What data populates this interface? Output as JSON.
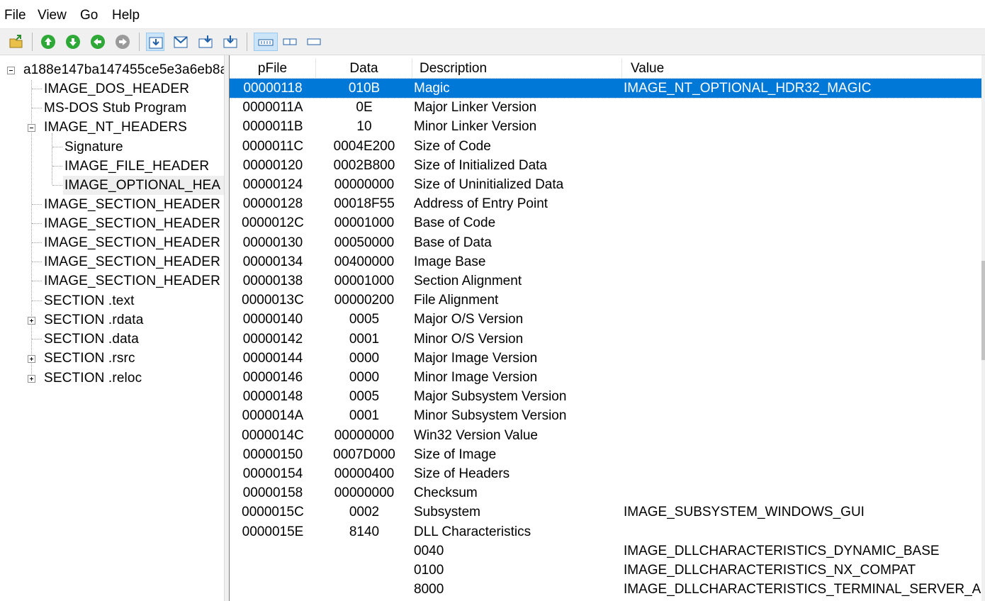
{
  "menu": [
    "File",
    "View",
    "Go",
    "Help"
  ],
  "toolbar": {
    "icons": [
      "open-icon",
      "arrow-up-icon",
      "arrow-down-icon",
      "arrow-back-icon",
      "arrow-forward-icon",
      "expand-view-icon",
      "mail-view-icon",
      "import-icon",
      "export-icon",
      "details-view-icon",
      "list-view-icon",
      "compact-view-icon"
    ]
  },
  "tree": {
    "root": "a188e147ba147455ce5e3a6eb8a",
    "items": [
      "IMAGE_DOS_HEADER",
      "MS-DOS Stub Program",
      "IMAGE_NT_HEADERS",
      "Signature",
      "IMAGE_FILE_HEADER",
      "IMAGE_OPTIONAL_HEA",
      "IMAGE_SECTION_HEADER",
      "IMAGE_SECTION_HEADER",
      "IMAGE_SECTION_HEADER",
      "IMAGE_SECTION_HEADER",
      "IMAGE_SECTION_HEADER",
      "SECTION .text",
      "SECTION .rdata",
      "SECTION .data",
      "SECTION .rsrc",
      "SECTION .reloc"
    ]
  },
  "table": {
    "columns": [
      "pFile",
      "Data",
      "Description",
      "Value"
    ],
    "rows": [
      {
        "pfile": "00000118",
        "data": "010B",
        "desc": "Magic",
        "value": "IMAGE_NT_OPTIONAL_HDR32_MAGIC"
      },
      {
        "pfile": "0000011A",
        "data": "0E",
        "desc": "Major Linker Version",
        "value": ""
      },
      {
        "pfile": "0000011B",
        "data": "10",
        "desc": "Minor Linker Version",
        "value": ""
      },
      {
        "pfile": "0000011C",
        "data": "0004E200",
        "desc": "Size of Code",
        "value": ""
      },
      {
        "pfile": "00000120",
        "data": "0002B800",
        "desc": "Size of Initialized Data",
        "value": ""
      },
      {
        "pfile": "00000124",
        "data": "00000000",
        "desc": "Size of Uninitialized Data",
        "value": ""
      },
      {
        "pfile": "00000128",
        "data": "00018F55",
        "desc": "Address of Entry Point",
        "value": ""
      },
      {
        "pfile": "0000012C",
        "data": "00001000",
        "desc": "Base of Code",
        "value": ""
      },
      {
        "pfile": "00000130",
        "data": "00050000",
        "desc": "Base of Data",
        "value": ""
      },
      {
        "pfile": "00000134",
        "data": "00400000",
        "desc": "Image Base",
        "value": ""
      },
      {
        "pfile": "00000138",
        "data": "00001000",
        "desc": "Section Alignment",
        "value": ""
      },
      {
        "pfile": "0000013C",
        "data": "00000200",
        "desc": "File Alignment",
        "value": ""
      },
      {
        "pfile": "00000140",
        "data": "0005",
        "desc": "Major O/S Version",
        "value": ""
      },
      {
        "pfile": "00000142",
        "data": "0001",
        "desc": "Minor O/S Version",
        "value": ""
      },
      {
        "pfile": "00000144",
        "data": "0000",
        "desc": "Major Image Version",
        "value": ""
      },
      {
        "pfile": "00000146",
        "data": "0000",
        "desc": "Minor Image Version",
        "value": ""
      },
      {
        "pfile": "00000148",
        "data": "0005",
        "desc": "Major Subsystem Version",
        "value": ""
      },
      {
        "pfile": "0000014A",
        "data": "0001",
        "desc": "Minor Subsystem Version",
        "value": ""
      },
      {
        "pfile": "0000014C",
        "data": "00000000",
        "desc": "Win32 Version Value",
        "value": ""
      },
      {
        "pfile": "00000150",
        "data": "0007D000",
        "desc": "Size of Image",
        "value": ""
      },
      {
        "pfile": "00000154",
        "data": "00000400",
        "desc": "Size of Headers",
        "value": ""
      },
      {
        "pfile": "00000158",
        "data": "00000000",
        "desc": "Checksum",
        "value": ""
      },
      {
        "pfile": "0000015C",
        "data": "0002",
        "desc": "Subsystem",
        "value": "IMAGE_SUBSYSTEM_WINDOWS_GUI"
      },
      {
        "pfile": "0000015E",
        "data": "8140",
        "desc": "DLL Characteristics",
        "value": ""
      },
      {
        "pfile": "",
        "data": "",
        "desc": "0040",
        "value": "IMAGE_DLLCHARACTERISTICS_DYNAMIC_BASE"
      },
      {
        "pfile": "",
        "data": "",
        "desc": "0100",
        "value": "IMAGE_DLLCHARACTERISTICS_NX_COMPAT"
      },
      {
        "pfile": "",
        "data": "",
        "desc": "8000",
        "value": "IMAGE_DLLCHARACTERISTICS_TERMINAL_SERVER_A"
      }
    ]
  },
  "colors": {
    "selection": "#0078d7",
    "toolbar_bg": "#f0f0f0",
    "icon_green": "#2ea836"
  }
}
